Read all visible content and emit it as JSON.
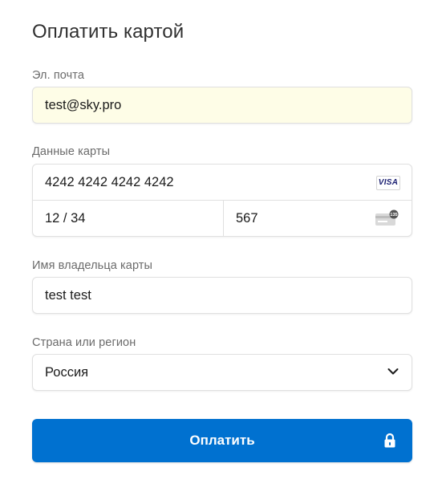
{
  "header": {
    "title": "Оплатить картой"
  },
  "email": {
    "label": "Эл. почта",
    "value": "test@sky.pro"
  },
  "card": {
    "label": "Данные карты",
    "number": "4242 4242 4242 4242",
    "expiry": "12 / 34",
    "cvc": "567",
    "brand": "VISA",
    "cvc_icon_text": "135"
  },
  "cardholder": {
    "label": "Имя владельца карты",
    "value": "test test"
  },
  "country": {
    "label": "Страна или регион",
    "value": "Россия"
  },
  "submit": {
    "label": "Оплатить"
  },
  "colors": {
    "accent": "#0071d0",
    "autofill": "#fefde7",
    "visa": "#1a1f71"
  },
  "icons": {
    "brand": "visa-card-icon",
    "cvc": "cvc-card-icon",
    "select": "chevron-down-icon",
    "submit": "lock-icon"
  }
}
